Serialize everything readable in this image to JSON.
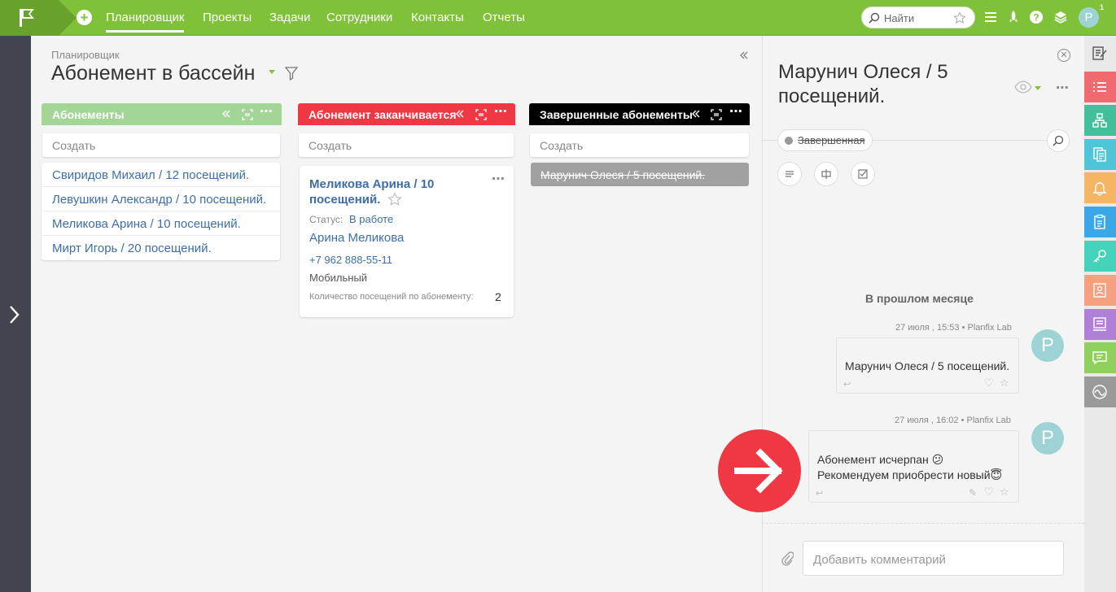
{
  "topbar": {
    "nav": [
      "Планировщик",
      "Проекты",
      "Задачи",
      "Сотрудники",
      "Контакты",
      "Отчеты"
    ],
    "active_nav": "Планировщик",
    "search_placeholder": "Найти",
    "avatar_letter": "P",
    "avatar_badge": "1",
    "icons": [
      "menu-icon",
      "rocket-icon",
      "help-icon",
      "layers-icon"
    ]
  },
  "board": {
    "breadcrumb": "Планировщик",
    "title": "Абонемент в бассейн",
    "create_label": "Создать",
    "columns": [
      {
        "title": "Абонементы",
        "color": "#a3d596",
        "items": [
          "Свиридов Михаил / 12 посещений.",
          "Левушкин Александр / 10 посещений.",
          "Меликова Арина / 10 посещений.",
          "Мирт Игорь / 20 посещений."
        ]
      },
      {
        "title": "Абонемент заканчивается",
        "color": "#ef3844",
        "card": {
          "title": "Меликова Арина / 10 посещений.",
          "status_label": "Статус:",
          "status_value": "В работе",
          "contact_name": "Арина Меликова",
          "phone": "+7 962 888-55-11",
          "phone_type": "Мобильный",
          "visits_label": "Количество посещений по абонементу:",
          "visits_value": "2"
        }
      },
      {
        "title": "Завершенные абонементы",
        "color": "#000000",
        "items": [
          "Марунич Олеся / 5 посещений."
        ]
      }
    ]
  },
  "panel": {
    "title": "Марунич Олеся / 5 посещений.",
    "status": "Завершенная",
    "section_label": "В прошлом месяце",
    "messages": [
      {
        "meta": "27 июля , 15:53 • Planfix Lab",
        "lines": [
          "Марунич Олеся / 5 посещений."
        ],
        "avatar": "P"
      },
      {
        "meta": "27 июля , 16:02 • Planfix Lab",
        "lines": [
          "Абонемент исчерпан 😕",
          "Рекомендуем приобрести новый😇"
        ],
        "avatar": "P"
      }
    ],
    "comment_placeholder": "Добавить комментарий"
  },
  "right_sidebar": [
    {
      "icon": "edit-icon",
      "color": "#e9e9e9"
    },
    {
      "icon": "list-icon",
      "color": "#f06a6f"
    },
    {
      "icon": "structure-icon",
      "color": "#3fbf9a"
    },
    {
      "icon": "documents-icon",
      "color": "#4fc6d8"
    },
    {
      "icon": "bell-icon",
      "color": "#f6b562"
    },
    {
      "icon": "clipboard-icon",
      "color": "#3aa7e6"
    },
    {
      "icon": "key-icon",
      "color": "#44d2ba"
    },
    {
      "icon": "contact-icon",
      "color": "#f7a07f"
    },
    {
      "icon": "inbox-icon",
      "color": "#b07fd8"
    },
    {
      "icon": "chat-icon",
      "color": "#8fd05c"
    },
    {
      "icon": "activity-icon",
      "color": "#9a9a9a"
    }
  ]
}
